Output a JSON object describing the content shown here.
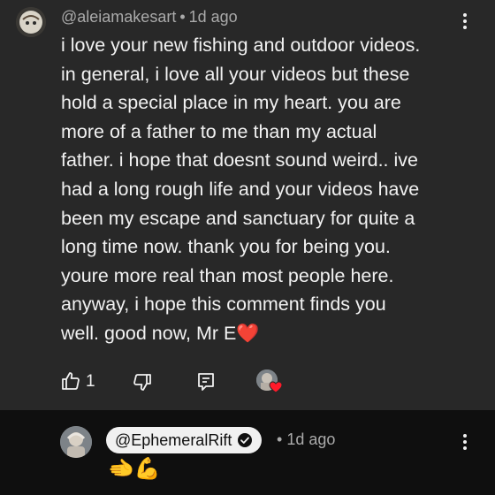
{
  "comment": {
    "handle": "@aleiamakesart",
    "separator": "•",
    "timestamp": "1d ago",
    "body": "i love your new fishing and outdoor videos.\nin general, i love all your videos but these\nhold a special place in my heart. you are\nmore of a father to me than my actual\nfather. i hope that doesnt sound weird.. ive\nhad a long rough life and your videos have\nbeen my escape and sanctuary for quite a\nlong time now. thank you for being you.\nyoure more real than most people here.\nanyway, i hope this comment finds you\nwell. good now, Mr E",
    "body_emoji": "❤️",
    "like_count": "1"
  },
  "reply": {
    "handle": "@EphemeralRift",
    "separator": "•",
    "timestamp": "1d ago",
    "emojis": "🫲💪"
  },
  "icons": {
    "like": "thumbs-up-icon",
    "dislike": "thumbs-down-icon",
    "reply": "reply-icon",
    "more": "kebab-menu-icon",
    "verified": "verified-check-icon",
    "creator_heart": "creator-heart-icon"
  },
  "colors": {
    "comment_bg": "#282828",
    "page_bg": "#0f0f0f",
    "text_primary": "#f1f1f1",
    "text_secondary": "#aaaaaa",
    "heart": "#ff1a2a",
    "chip_bg": "#f1f1f1"
  }
}
